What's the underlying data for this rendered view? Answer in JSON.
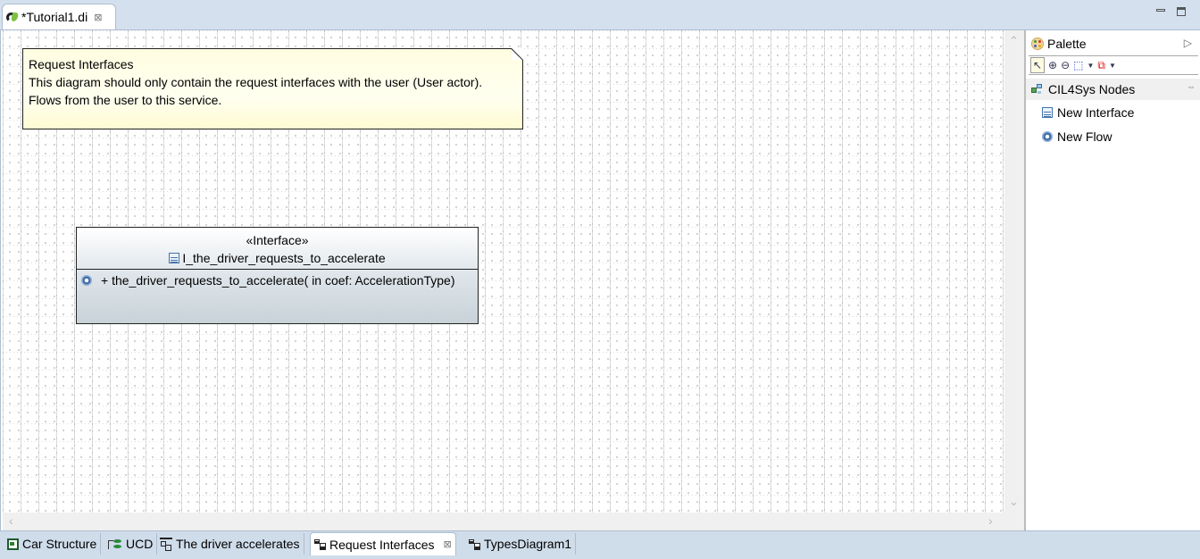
{
  "editor": {
    "tab_label": "*Tutorial1.di",
    "close_glyph": "⊠"
  },
  "window_controls": {
    "minimize": "minimize",
    "maximize": "maximize"
  },
  "diagram": {
    "note": {
      "lines": [
        "Request Interfaces",
        "This diagram should only contain the request interfaces with the user (User actor).",
        "Flows from the user to this service."
      ]
    },
    "interface": {
      "stereotype": "«Interface»",
      "name": "I_the_driver_requests_to_accelerate",
      "operations": [
        "+ the_driver_requests_to_accelerate(  in coef: AccelerationType)"
      ]
    }
  },
  "scrollbars": {
    "up": "⌃",
    "down": "⌄",
    "left": "‹",
    "right": "›"
  },
  "palette": {
    "title": "Palette",
    "collapse_glyph": "▷",
    "tools": [
      "select",
      "zoom-in",
      "zoom-out",
      "marquee",
      "connection-creation"
    ],
    "drawer": {
      "title": "CIL4Sys Nodes",
      "pin_glyph": "⇔",
      "entries": [
        {
          "label": "New Interface",
          "icon": "interface-icon"
        },
        {
          "label": "New Flow",
          "icon": "gear-icon"
        }
      ]
    }
  },
  "bottom_tabs": [
    {
      "label": "Car Structure",
      "icon": "composite-structure-icon",
      "active": false
    },
    {
      "label": "UCD",
      "icon": "use-case-icon",
      "active": false
    },
    {
      "label": "The driver accelerates",
      "icon": "activity-icon",
      "active": false
    },
    {
      "label": "Request Interfaces",
      "icon": "class-diagram-icon",
      "active": true
    },
    {
      "label": "TypesDiagram1",
      "icon": "class-diagram-icon",
      "active": false
    }
  ]
}
